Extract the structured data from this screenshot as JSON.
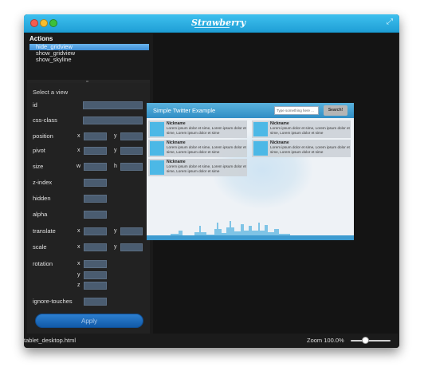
{
  "window": {
    "logo_text": "Strawberry",
    "expand_icon": "expand-icon"
  },
  "actions": {
    "title": "Actions",
    "items": [
      {
        "label": "hide_gridview",
        "selected": true
      },
      {
        "label": "show_gridview",
        "selected": false
      },
      {
        "label": "show_skyline",
        "selected": false
      }
    ]
  },
  "properties": {
    "title": "Select a view",
    "id": "id",
    "css_class": "css-class",
    "position": "position",
    "pivot": "pivot",
    "size": "size",
    "z_index": "z-index",
    "hidden": "hidden",
    "alpha": "alpha",
    "translate": "translate",
    "scale": "scale",
    "rotation": "rotation",
    "ignore_touches": "ignore-touches",
    "axis_x": "x",
    "axis_y": "y",
    "axis_z": "z",
    "axis_w": "w",
    "axis_h": "h",
    "apply_label": "Apply"
  },
  "preview": {
    "title": "Simple Twitter Example",
    "search_placeholder": "Type something here ...",
    "search_button": "Search!",
    "tweets": [
      {
        "name": "Nickname",
        "text": "Lorem ipsum dolor et sime, Lorem ipsum dolor et sime, Lorem ipsum dolor et sime"
      },
      {
        "name": "Nickname",
        "text": "Lorem ipsum dolor et sime, Lorem ipsum dolor et sime, Lorem ipsum dolor et sime"
      },
      {
        "name": "Nickname",
        "text": "Lorem ipsum dolor et sime, Lorem ipsum dolor et sime, Lorem ipsum dolor et sime"
      },
      {
        "name": "Nickname",
        "text": "Lorem ipsum dolor et sime, Lorem ipsum dolor et sime, Lorem ipsum dolor et sime"
      },
      {
        "name": "Nickname",
        "text": "Lorem ipsum dolor et sime, Lorem ipsum dolor et sime, Lorem ipsum dolor et sime"
      }
    ]
  },
  "status": {
    "file": "tablet_desktop.html",
    "zoom": "Zoom 100.0%",
    "zoom_value": 100
  },
  "colors": {
    "accent": "#1f9fd6",
    "selection": "#3f8fd7",
    "apply": "#125aa8"
  }
}
